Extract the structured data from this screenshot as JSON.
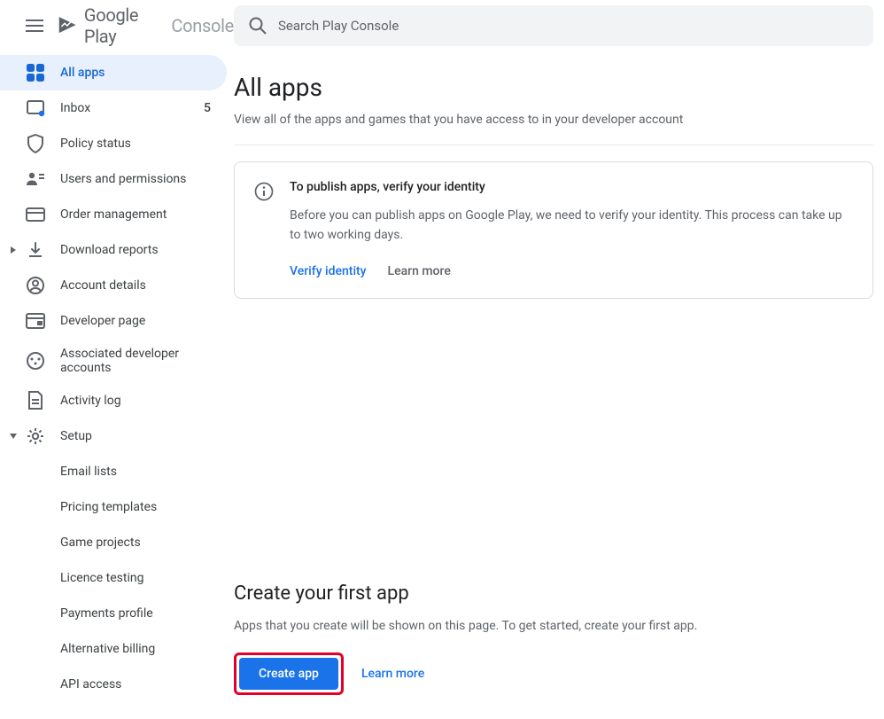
{
  "header": {
    "brand_text1": "Google Play",
    "brand_text2": "Console",
    "search_placeholder": "Search Play Console"
  },
  "sidebar": {
    "items": [
      {
        "key": "all-apps",
        "label": "All apps",
        "active": true
      },
      {
        "key": "inbox",
        "label": "Inbox",
        "badge": "5"
      },
      {
        "key": "policy-status",
        "label": "Policy status"
      },
      {
        "key": "users-permissions",
        "label": "Users and permissions"
      },
      {
        "key": "order-management",
        "label": "Order management"
      },
      {
        "key": "download-reports",
        "label": "Download reports",
        "expandable": true
      },
      {
        "key": "account-details",
        "label": "Account details"
      },
      {
        "key": "developer-page",
        "label": "Developer page"
      },
      {
        "key": "associated-accounts",
        "label": "Associated developer accounts"
      },
      {
        "key": "activity-log",
        "label": "Activity log"
      },
      {
        "key": "setup",
        "label": "Setup",
        "expandable": true,
        "expanded": true
      }
    ],
    "setup_children": [
      {
        "key": "email-lists",
        "label": "Email lists"
      },
      {
        "key": "pricing-templates",
        "label": "Pricing templates"
      },
      {
        "key": "game-projects",
        "label": "Game projects"
      },
      {
        "key": "licence-testing",
        "label": "Licence testing"
      },
      {
        "key": "payments-profile",
        "label": "Payments profile"
      },
      {
        "key": "alternative-billing",
        "label": "Alternative billing"
      },
      {
        "key": "api-access",
        "label": "API access"
      }
    ]
  },
  "main": {
    "title": "All apps",
    "subtitle": "View all of the apps and games that you have access to in your developer account",
    "info_card": {
      "title": "To publish apps, verify your identity",
      "body": "Before you can publish apps on Google Play, we need to verify your identity. This process can take up to two working days.",
      "action_primary": "Verify identity",
      "action_secondary": "Learn more"
    },
    "create_section": {
      "title": "Create your first app",
      "body": "Apps that you create will be shown on this page. To get started, create your first app.",
      "button": "Create app",
      "learn_more": "Learn more"
    }
  }
}
